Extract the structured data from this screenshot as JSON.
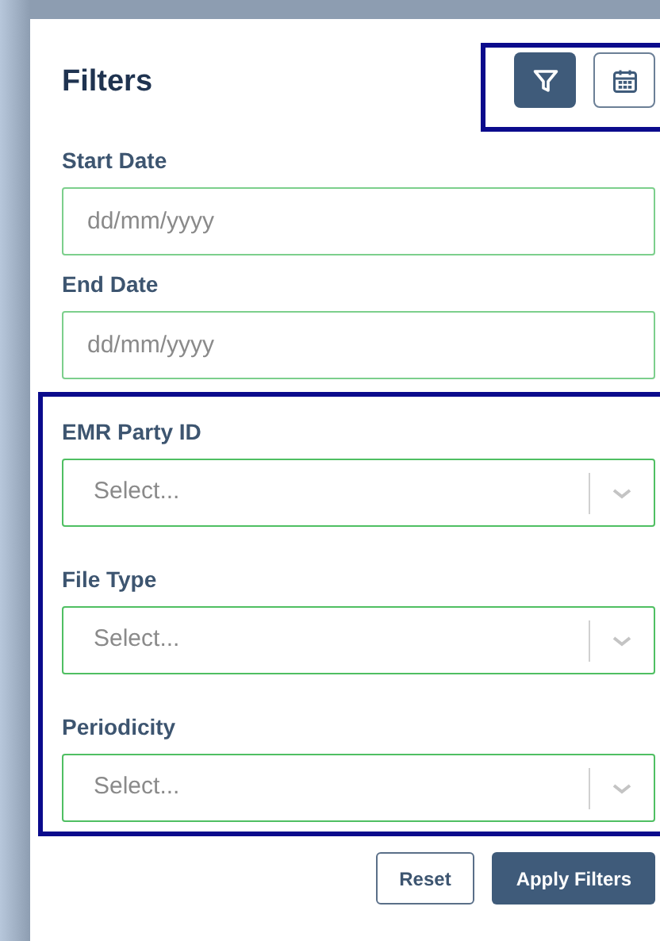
{
  "title": "Filters",
  "view_buttons": [
    {
      "kind": "filter",
      "selected": true
    },
    {
      "kind": "calendar",
      "selected": false
    }
  ],
  "date_fields": [
    {
      "label": "Start Date",
      "placeholder": "dd/mm/yyyy"
    },
    {
      "label": "End Date",
      "placeholder": "dd/mm/yyyy"
    }
  ],
  "select_fields": [
    {
      "label": "EMR Party ID",
      "placeholder": "Select..."
    },
    {
      "label": "File Type",
      "placeholder": "Select..."
    },
    {
      "label": "Periodicity",
      "placeholder": "Select..."
    }
  ],
  "buttons": [
    {
      "kind": "secondary",
      "label": "Reset"
    },
    {
      "kind": "primary",
      "label": "Apply Filters"
    }
  ]
}
